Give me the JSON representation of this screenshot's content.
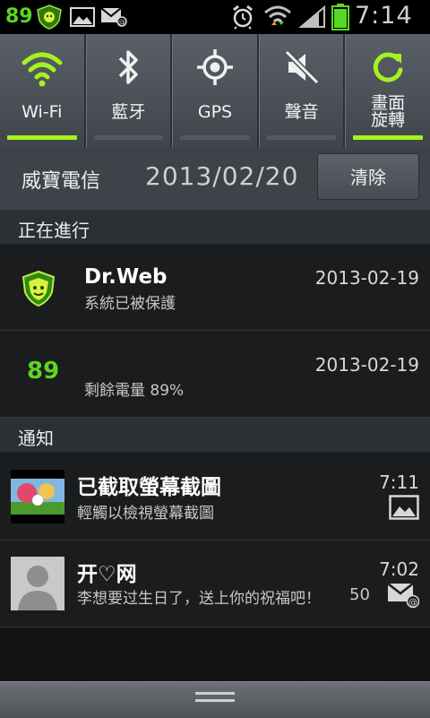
{
  "status_bar": {
    "battery_text": "89",
    "clock": "7:14",
    "icons": [
      "drweb-icon",
      "image-icon",
      "mail-icon",
      "alarm-icon",
      "wifi-icon",
      "signal-icon",
      "battery-icon"
    ],
    "battery_fraction": 0.89
  },
  "quick_settings": [
    {
      "label": "Wi-Fi",
      "icon": "wifi-icon",
      "on": true
    },
    {
      "label": "藍牙",
      "icon": "bluetooth-icon",
      "on": false
    },
    {
      "label": "GPS",
      "icon": "gps-icon",
      "on": false
    },
    {
      "label": "聲音",
      "icon": "sound-muted-icon",
      "on": false
    },
    {
      "label_line1": "畫面",
      "label_line2": "旋轉",
      "icon": "rotate-icon",
      "on": true
    }
  ],
  "carrier": {
    "name": "威寶電信",
    "date": "2013/02/20",
    "clear_label": "清除"
  },
  "ongoing": {
    "header": "正在進行",
    "items": [
      {
        "title": "Dr.Web",
        "text": "系統已被保護",
        "time": "2013-02-19",
        "icon": "drweb-shield-icon"
      },
      {
        "badge": "89",
        "text": "剩餘電量 89%",
        "time": "2013-02-19",
        "icon": "battery-badge-icon"
      }
    ]
  },
  "notifications": {
    "header": "通知",
    "items": [
      {
        "title": "已截取螢幕截圖",
        "text": "輕觸以檢視螢幕截圖",
        "time": "7:11",
        "icon": "screenshot-thumbnail",
        "side_icon": "image-icon"
      },
      {
        "title": "开♡网",
        "text": "李想要过生日了，送上你的祝福吧！",
        "count": "50",
        "time": "7:02",
        "icon": "avatar",
        "side_icon": "mail-icon"
      }
    ]
  },
  "colors": {
    "accent": "#a6f21f",
    "battery_green": "#59d823"
  }
}
